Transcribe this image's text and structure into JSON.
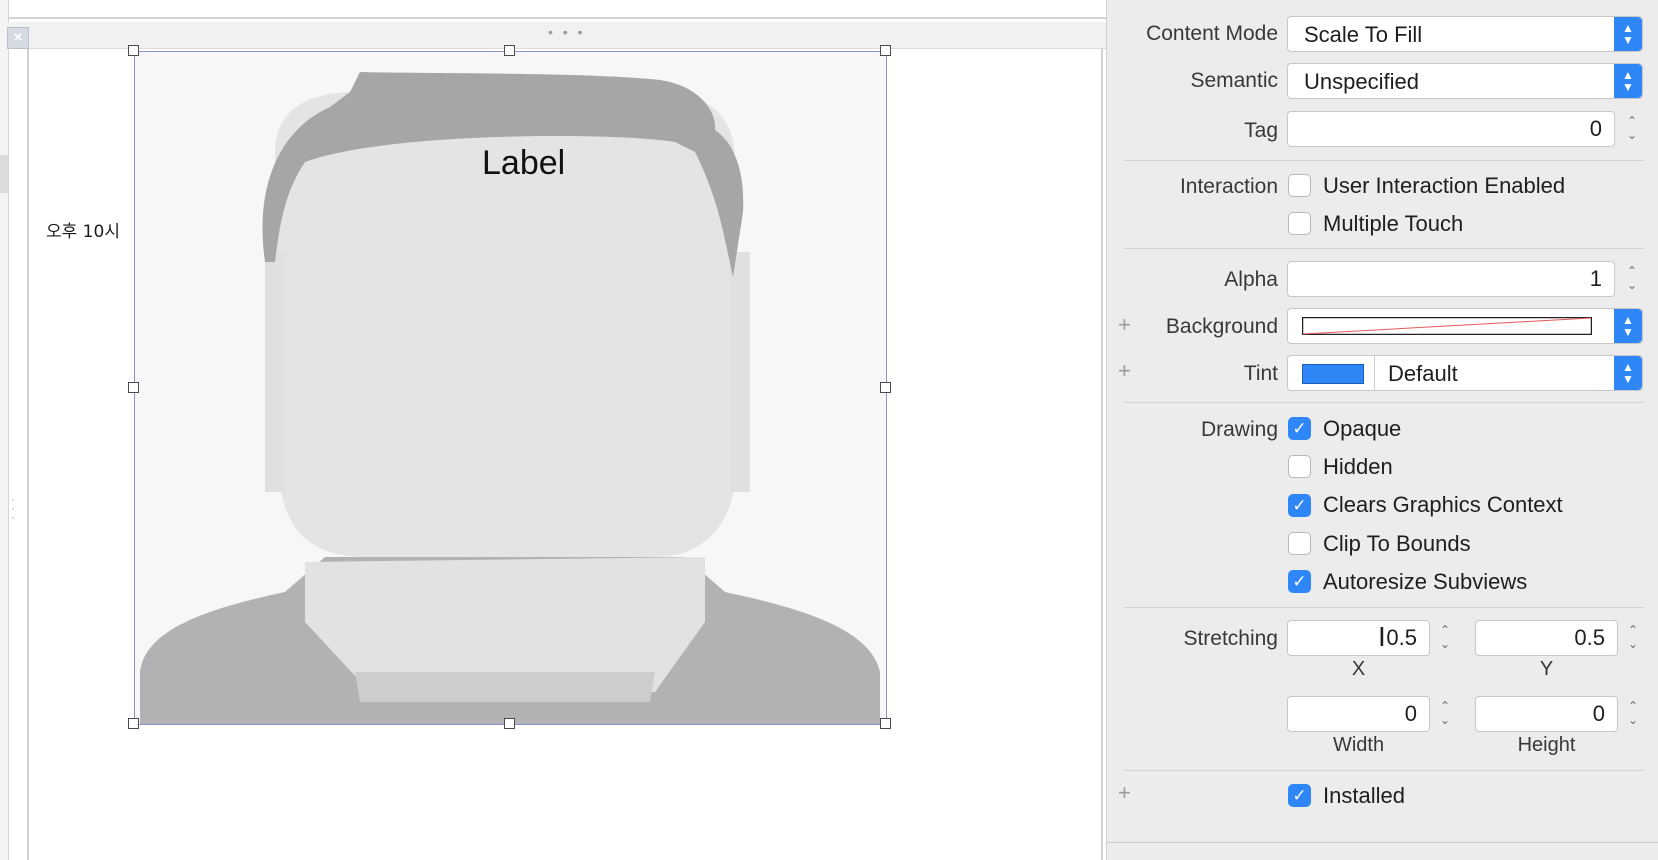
{
  "canvas": {
    "time_label": "오후 10시",
    "image_label": "Label",
    "ellipsis": "• • •"
  },
  "inspector": {
    "content_mode": {
      "label": "Content Mode",
      "value": "Scale To Fill"
    },
    "semantic": {
      "label": "Semantic",
      "value": "Unspecified"
    },
    "tag": {
      "label": "Tag",
      "value": "0"
    },
    "interaction": {
      "label": "Interaction",
      "user_interaction_enabled": {
        "label": "User Interaction Enabled",
        "checked": false
      },
      "multiple_touch": {
        "label": "Multiple Touch",
        "checked": false
      }
    },
    "alpha": {
      "label": "Alpha",
      "value": "1"
    },
    "background": {
      "label": "Background"
    },
    "tint": {
      "label": "Tint",
      "value": "Default",
      "color": "#2f86f6"
    },
    "drawing": {
      "label": "Drawing",
      "opaque": {
        "label": "Opaque",
        "checked": true
      },
      "hidden": {
        "label": "Hidden",
        "checked": false
      },
      "clears_graphics_context": {
        "label": "Clears Graphics Context",
        "checked": true
      },
      "clip_to_bounds": {
        "label": "Clip To Bounds",
        "checked": false
      },
      "autoresize_subviews": {
        "label": "Autoresize Subviews",
        "checked": true
      }
    },
    "stretching": {
      "label": "Stretching",
      "x": {
        "value": "0.5",
        "label": "X"
      },
      "y": {
        "value": "0.5",
        "label": "Y"
      },
      "width": {
        "value": "0",
        "label": "Width"
      },
      "height": {
        "value": "0",
        "label": "Height"
      }
    },
    "installed": {
      "label": "Installed",
      "checked": true
    }
  },
  "icons": [
    "close-icon",
    "plus-icon",
    "chevron-updown-icon",
    "checkmark-icon",
    "text-cursor-icon",
    "person-placeholder-icon"
  ],
  "colors": {
    "accent": "#2f86f6",
    "selection_border": "#8f93cf",
    "inspector_bg": "#ececec"
  }
}
